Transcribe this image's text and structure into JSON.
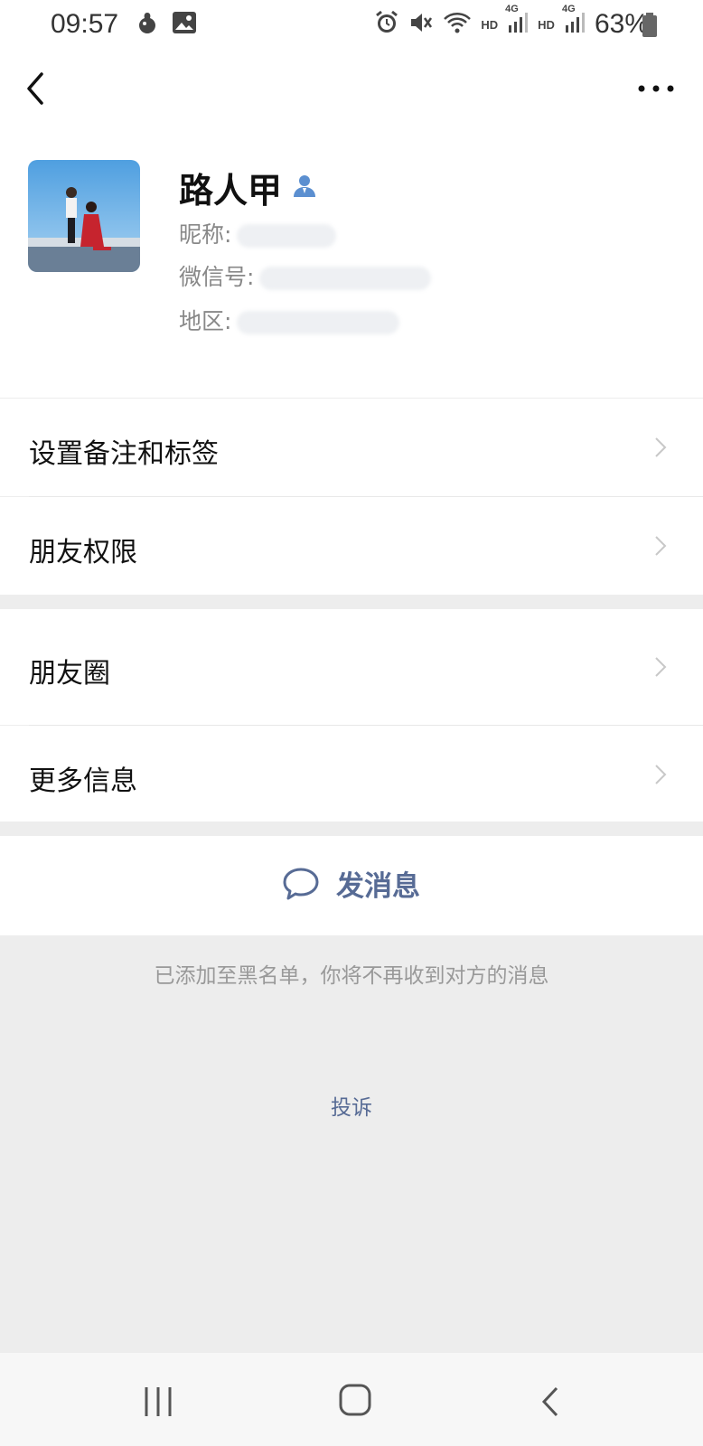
{
  "status_bar": {
    "time": "09:57",
    "battery": "63%",
    "hd1": "HD",
    "hd2": "HD",
    "net1": "4G",
    "net2": "4G"
  },
  "header": {
    "back_icon": "chevron-left-icon",
    "more_icon": "more-dots-icon"
  },
  "profile": {
    "name": "路人甲",
    "nickname_label": "昵称:",
    "wechat_id_label": "微信号:",
    "region_label": "地区:"
  },
  "menu": {
    "remark_tags": "设置备注和标签",
    "friend_permissions": "朋友权限",
    "moments": "朋友圈",
    "more_info": "更多信息"
  },
  "actions": {
    "send_message": "发消息"
  },
  "notice": "已添加至黑名单，你将不再收到对方的消息",
  "complain": "投诉",
  "colors": {
    "link_blue": "#576b95",
    "background": "#ededed"
  }
}
